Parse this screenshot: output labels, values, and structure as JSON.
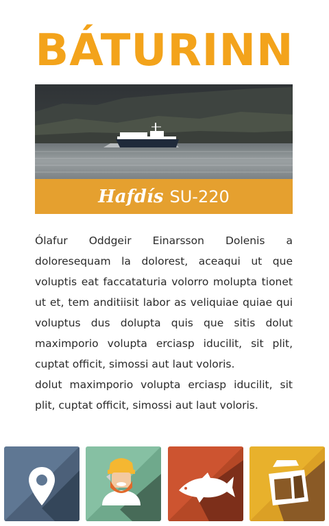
{
  "header": {
    "title": "BÁTURINN"
  },
  "boat": {
    "name": "Hafdís",
    "registration": "SU-220"
  },
  "description": {
    "paragraph_1": "Ólafur Oddgeir Einarsson Dolenis a doloresequam la dolorest, aceaqui ut que voluptis eat faccataturia volorro molupta tionet ut et, tem anditiisit labor as veliquiae quiae qui voluptus dus dolupta quis que sitis dolut maximporio volupta erciasp iducilit, sit plit, cuptat officit, simossi aut laut voloris.",
    "paragraph_2": "dolut maximporio volupta erciasp iducilit, sit plit, cuptat officit, simossi aut laut voloris."
  },
  "colors": {
    "title": "#f3a31b",
    "caption_bar": "#e5a02f",
    "tile_location": "#5f7793",
    "tile_crew": "#86c0a3",
    "tile_fish": "#cd5430",
    "tile_boat": "#e8b12c"
  },
  "tiles": [
    {
      "icon": "location-pin-icon"
    },
    {
      "icon": "fisherman-icon"
    },
    {
      "icon": "fish-icon"
    },
    {
      "icon": "boat-icon"
    }
  ]
}
